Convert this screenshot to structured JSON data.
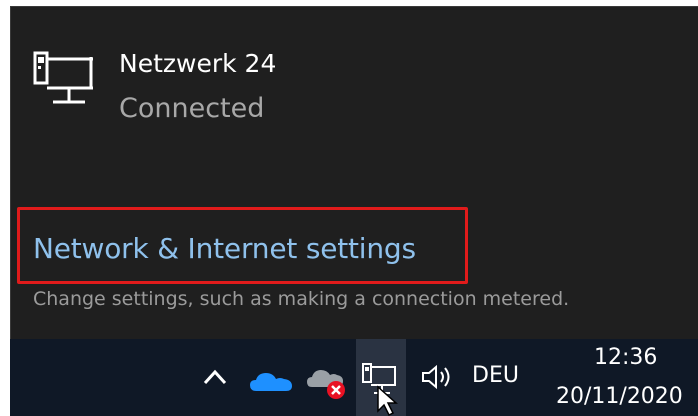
{
  "network": {
    "name": "Netzwerk 24",
    "status": "Connected",
    "icon": "ethernet-network-icon"
  },
  "settings": {
    "link_label": "Network & Internet settings",
    "description": "Change settings, such as making a connection metered."
  },
  "taskbar": {
    "icons": [
      "chevron-up-icon",
      "onedrive-icon",
      "onedrive-error-icon",
      "network-tray-icon",
      "volume-icon"
    ],
    "language": "DEU",
    "time": "12:36",
    "date": "20/11/2020"
  },
  "colors": {
    "flyout_bg": "#1f1f1f",
    "taskbar_bg": "#0f1826",
    "link": "#8fc1ec",
    "highlight": "#e01b1b",
    "onedrive": "#1e90ff",
    "error": "#e81123"
  }
}
